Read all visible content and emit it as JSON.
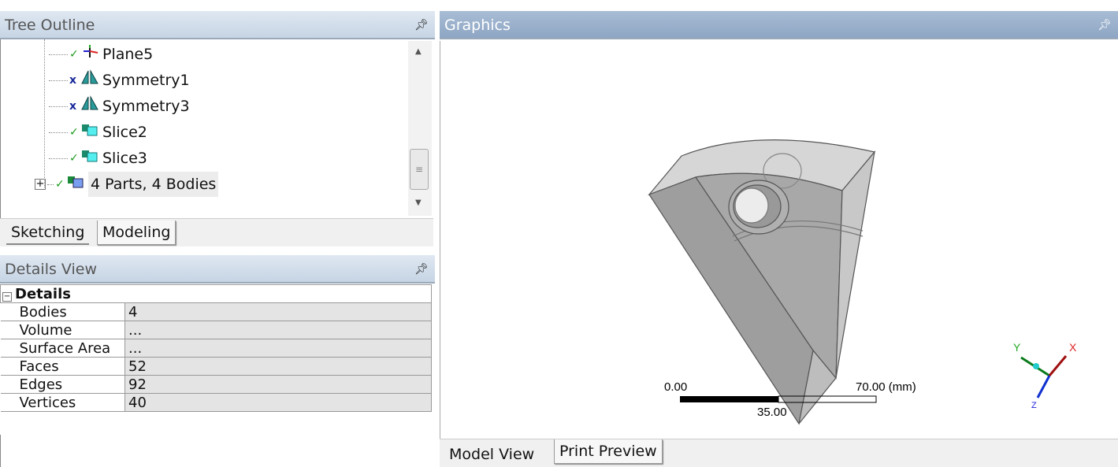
{
  "tree": {
    "title": "Tree Outline",
    "items": [
      {
        "label": "Plane5",
        "status": "check",
        "icon": "plane-icon"
      },
      {
        "label": "Symmetry1",
        "status": "x",
        "icon": "symmetry-icon"
      },
      {
        "label": "Symmetry3",
        "status": "x",
        "icon": "symmetry-icon"
      },
      {
        "label": "Slice2",
        "status": "check",
        "icon": "slice-icon"
      },
      {
        "label": "Slice3",
        "status": "check",
        "icon": "slice-icon"
      },
      {
        "label": "4 Parts, 4 Bodies",
        "status": "check",
        "icon": "parts-icon",
        "expandable": true
      }
    ],
    "tabs": [
      "Sketching",
      "Modeling"
    ],
    "active_tab": "Modeling"
  },
  "details": {
    "title": "Details View",
    "section": "Details",
    "rows": [
      {
        "k": "Bodies",
        "v": "4"
      },
      {
        "k": "Volume",
        "v": "..."
      },
      {
        "k": "Surface Area",
        "v": "..."
      },
      {
        "k": "Faces",
        "v": "52"
      },
      {
        "k": "Edges",
        "v": "92"
      },
      {
        "k": "Vertices",
        "v": "40"
      }
    ]
  },
  "graphics": {
    "title": "Graphics",
    "scale": {
      "start": "0.00",
      "mid": "35.00",
      "end": "70.00 (mm)"
    },
    "axes": {
      "x": "X",
      "y": "Y",
      "z": "Z"
    },
    "tabs": [
      "Model View",
      "Print Preview"
    ],
    "active_tab": "Model View"
  },
  "pin_glyph": "Ԃ"
}
